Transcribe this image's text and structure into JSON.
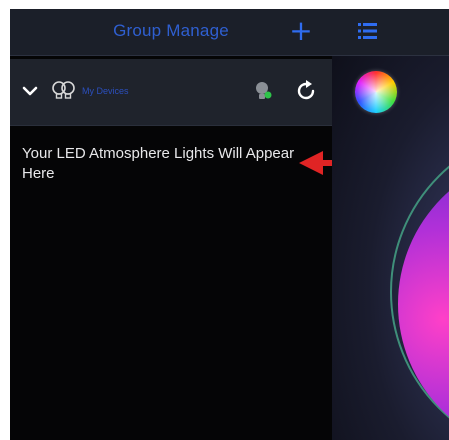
{
  "sidebar": {
    "title": "Group Manage",
    "add_icon": "plus-icon",
    "group": {
      "label": "My Devices",
      "expand_icon": "chevron-down-icon",
      "group_icon": "bulbs-icon",
      "bulb_icon": "bulb-toggle-icon",
      "refresh_icon": "refresh-icon"
    },
    "empty_message": "Your LED Atmosphere Lights Will Appear Here"
  },
  "main": {
    "menu_icon": "list-icon",
    "color_picker_icon": "color-wheel-icon"
  },
  "colors": {
    "accent_blue": "#2f5fd0",
    "arrow_red": "#e02424",
    "header_bg": "#1b1f29"
  }
}
